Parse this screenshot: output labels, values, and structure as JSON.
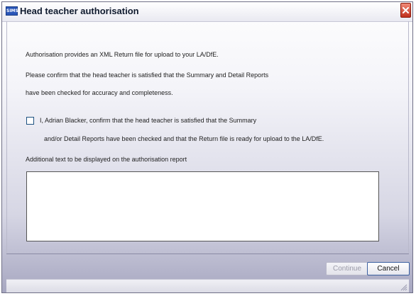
{
  "window": {
    "app_icon_text": "SIMS",
    "title": "Head teacher authorisation"
  },
  "content": {
    "line1": "Authorisation provides an XML Return file for upload to your LA/DfE.",
    "line2": "Please confirm that the head teacher is satisfied that the Summary and Detail Reports",
    "line3": "have been checked for accuracy and completeness.",
    "confirm_line1": "I, Adrian Blacker, confirm that the head teacher is satisfied that the Summary",
    "confirm_line2": "and/or Detail Reports have been checked and that the Return file is ready for upload to the LA/DfE.",
    "confirm_checked": false,
    "additional_label": "Additional text to be displayed on the authorisation report",
    "additional_value": ""
  },
  "footer": {
    "continue_label": "Continue",
    "cancel_label": "Cancel"
  },
  "colors": {
    "title_bar": "#ffffff",
    "window_gradient_bottom": "#a6a6c0",
    "close_button": "#c0301c"
  }
}
